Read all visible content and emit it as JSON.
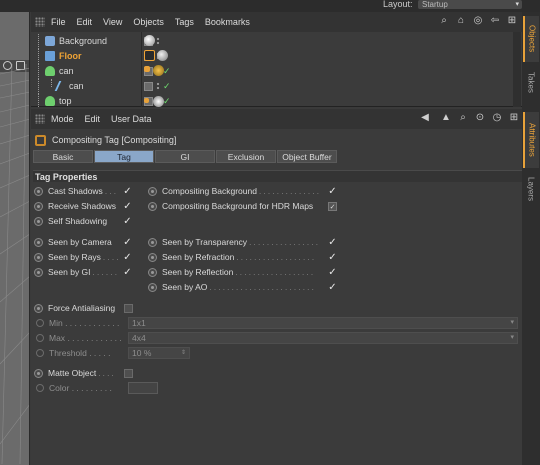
{
  "top": {
    "layout_label": "Layout:",
    "layout_value": "Startup"
  },
  "side_tabs": [
    "Objects",
    "Takes",
    "Attributes",
    "Layers"
  ],
  "object_manager": {
    "menu": [
      "File",
      "Edit",
      "View",
      "Objects",
      "Tags",
      "Bookmarks"
    ],
    "objects": [
      {
        "name": "Background"
      },
      {
        "name": "Floor"
      },
      {
        "name": "can"
      },
      {
        "name": "can"
      },
      {
        "name": "top"
      }
    ]
  },
  "attributes": {
    "menu": [
      "Mode",
      "Edit",
      "User Data"
    ],
    "title": "Compositing Tag [Compositing]",
    "tabs": [
      "Basic",
      "Tag",
      "GI",
      "Exclusion",
      "Object Buffer"
    ],
    "active_tab": "Tag",
    "section": "Tag Properties",
    "left_options": [
      {
        "label": "Cast Shadows",
        "leader": ". . .",
        "checked": true
      },
      {
        "label": "Receive Shadows",
        "leader": "",
        "checked": true
      },
      {
        "label": "Self Shadowing",
        "leader": "",
        "checked": true
      },
      {
        "label": "Seen by Camera",
        "leader": "",
        "checked": true
      },
      {
        "label": "Seen by Rays",
        "leader": ". . . .",
        "checked": true
      },
      {
        "label": "Seen by GI",
        "leader": ". . . . . .",
        "checked": true
      }
    ],
    "right_options": [
      {
        "label": "Compositing Background",
        "leader": ". . . . . . . . . . . . . .",
        "checked": true
      },
      {
        "label": "Compositing Background for HDR Maps",
        "leader": "",
        "checked": "partial"
      },
      {
        "label": "Seen by Transparency",
        "leader": ". . . . . . . . . . . . . . . .",
        "checked": true
      },
      {
        "label": "Seen by Refraction",
        "leader": ". . . . . . . . . . . . . . . . . .",
        "checked": true
      },
      {
        "label": "Seen by Reflection",
        "leader": ". . . . . . . . . . . . . . . . . .",
        "checked": true
      },
      {
        "label": "Seen by AO",
        "leader": ". . . . . . . . . . . . . . . . . . . . . . . .",
        "checked": true
      }
    ],
    "force_antialiasing": {
      "label": "Force Antialiasing",
      "checked": false
    },
    "min": {
      "label": "Min",
      "leader": ". . . . . . . . . . . .",
      "value": "1x1"
    },
    "max": {
      "label": "Max",
      "leader": ". . . . . . . . . . . .",
      "value": "4x4"
    },
    "threshold": {
      "label": "Threshold",
      "leader": ". . . . .",
      "value": "10 %"
    },
    "matte_object": {
      "label": "Matte Object",
      "leader": ". . . .",
      "checked": false
    },
    "color": {
      "label": "Color",
      "leader": ". . . . . . . . .",
      "value": "#444444"
    }
  }
}
